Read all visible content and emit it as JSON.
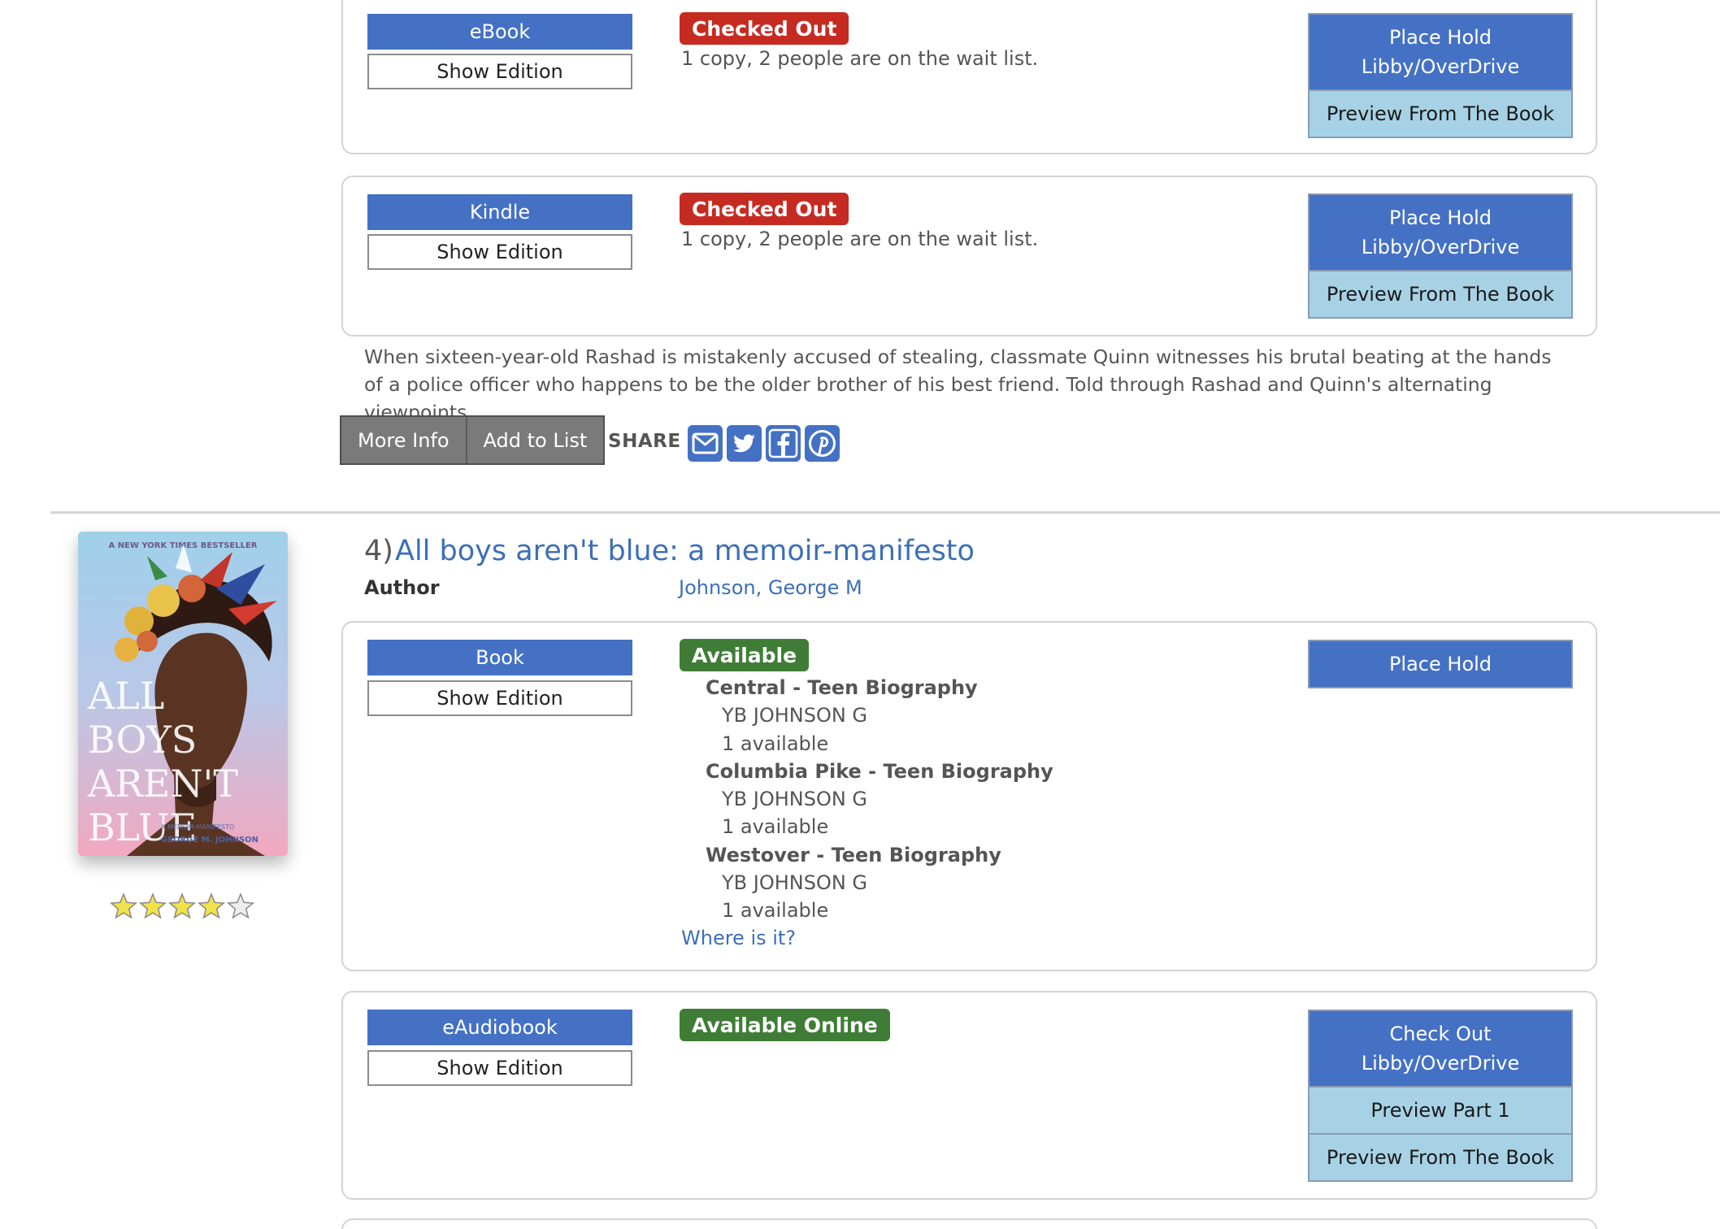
{
  "top_record": {
    "formats": [
      {
        "format": "eBook",
        "show_edition": "Show Edition",
        "status": "Checked Out",
        "note": "1 copy, 2 people are on the wait list.",
        "actions": [
          "Place Hold",
          "Libby/OverDrive"
        ],
        "secondary": [
          "Preview From The Book"
        ]
      },
      {
        "format": "Kindle",
        "show_edition": "Show Edition",
        "status": "Checked Out",
        "note": "1 copy, 2 people are on the wait list.",
        "actions": [
          "Place Hold",
          "Libby/OverDrive"
        ],
        "secondary": [
          "Preview From The Book"
        ]
      }
    ],
    "summary": "When sixteen-year-old Rashad is mistakenly accused of stealing, classmate Quinn witnesses his brutal beating at the hands of a police officer who happens to be the older brother of his best friend. Told through Rashad and Quinn's alternating viewpoints.",
    "buttons": {
      "more_info": "More Info",
      "add_to_list": "Add to List"
    },
    "share_label": "SHARE",
    "share_icons": [
      "email-icon",
      "twitter-icon",
      "facebook-icon",
      "pinterest-icon"
    ]
  },
  "result": {
    "number": "4)",
    "title": "All boys aren't blue: a memoir-manifesto",
    "author_label": "Author",
    "author": "Johnson, George M",
    "rating": 4,
    "rating_max": 5,
    "cover": {
      "top_banner": "A NEW YORK TIMES BESTSELLER",
      "title_lines": [
        "ALL",
        "BOYS",
        "AREN'T",
        "BLUE"
      ],
      "subtitle": "A MEMOIR-MANIFESTO",
      "author": "GEORGE M. JOHNSON"
    },
    "book_format": {
      "format": "Book",
      "show_edition": "Show Edition",
      "status": "Available",
      "action": "Place Hold",
      "holdings": [
        {
          "location": "Central - Teen Biography",
          "call_number": "YB JOHNSON G",
          "availability": "1 available"
        },
        {
          "location": "Columbia Pike - Teen Biography",
          "call_number": "YB JOHNSON G",
          "availability": "1 available"
        },
        {
          "location": "Westover - Teen Biography",
          "call_number": "YB JOHNSON G",
          "availability": "1 available"
        }
      ],
      "where_link": "Where is it?"
    },
    "eaudio_format": {
      "format": "eAudiobook",
      "show_edition": "Show Edition",
      "status": "Available Online",
      "actions": [
        "Check Out",
        "Libby/OverDrive"
      ],
      "secondary": [
        "Preview Part 1",
        "Preview From The Book"
      ]
    }
  },
  "colors": {
    "primary_blue": "#4471c4",
    "light_blue": "#a7d2e6",
    "checked_out_red": "#c62b22",
    "available_green": "#3f7d36",
    "link_blue": "#3d6fb6"
  }
}
